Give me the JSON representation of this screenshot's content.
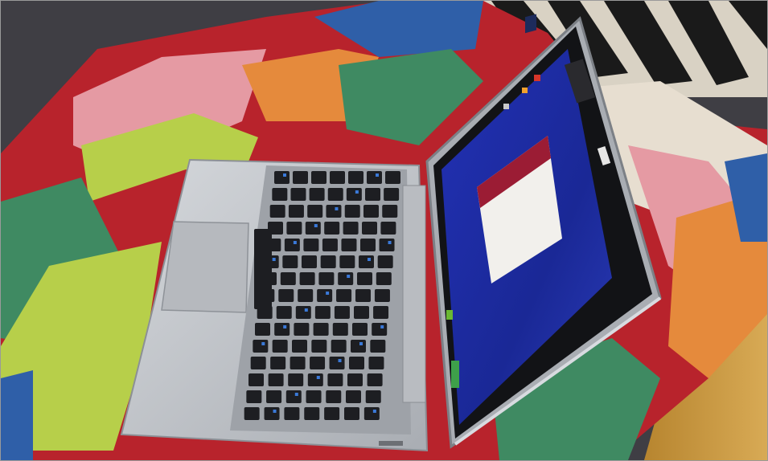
{
  "photo": {
    "subject": "convertible-laptop-with-detachable-screen-on-patchwork-blanket",
    "colors": {
      "sofa": "#3f3e44",
      "blanket_red": "#b8232c",
      "blanket_pink": "#e59aa3",
      "blanket_orange": "#e58a3c",
      "blanket_green": "#3f8a62",
      "blanket_lime": "#b7cf4a",
      "blanket_blue": "#2f5fa8",
      "blanket_cream": "#e7ded0",
      "floor_wood": "#c99a45",
      "chassis_silver": "#c4c7cc",
      "keycap": "#1d1e22",
      "key_accent": "#3a79d8",
      "desktop_blue": "#1f2fa8",
      "bezel": "#121316"
    },
    "icons": [
      "start-tile-icon",
      "desktop-shortcut-icon",
      "logo-sticker-icon"
    ]
  }
}
